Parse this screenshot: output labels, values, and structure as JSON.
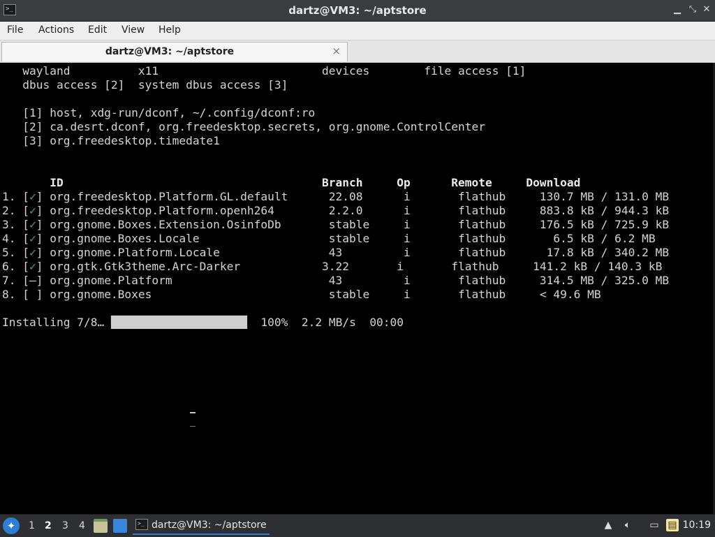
{
  "window": {
    "title": "dartz@VM3: ~/aptstore",
    "app_icon": "terminal-icon",
    "controls": [
      "minimize-icon",
      "restore-icon",
      "close-icon"
    ]
  },
  "menubar": {
    "items": [
      "File",
      "Actions",
      "Edit",
      "View",
      "Help"
    ]
  },
  "tabs": [
    {
      "label": "dartz@VM3: ~/aptstore",
      "close": "×"
    }
  ],
  "terminal": {
    "permissions": [
      "   wayland          x11                        devices        file access [1]",
      "   dbus access [2]  system dbus access [3]"
    ],
    "notes": [
      "   [1] host, xdg-run/dconf, ~/.config/dconf:ro",
      "   [2] ca.desrt.dconf, org.freedesktop.secrets, org.gnome.ControlCenter",
      "   [3] org.freedesktop.timedate1"
    ],
    "header": "       ID                                      Branch     Op      Remote     Download",
    "rows": [
      {
        "prefix": "1. [",
        "mark": "✓",
        "text": "] org.freedesktop.Platform.GL.default      22.08      i       flathub     130.7 MB / 131.0 MB"
      },
      {
        "prefix": "2. [",
        "mark": "✓",
        "text": "] org.freedesktop.Platform.openh264        2.2.0      i       flathub     883.8 kB / 944.3 kB"
      },
      {
        "prefix": "3. [",
        "mark": "✓",
        "text": "] org.gnome.Boxes.Extension.OsinfoDb       stable     i       flathub     176.5 kB / 725.9 kB"
      },
      {
        "prefix": "4. [",
        "mark": "✓",
        "text": "] org.gnome.Boxes.Locale                   stable     i       flathub       6.5 kB / 6.2 MB"
      },
      {
        "prefix": "5. [",
        "mark": "✓",
        "text": "] org.gnome.Platform.Locale                43         i       flathub      17.8 kB / 340.2 MB"
      },
      {
        "prefix": "6. [",
        "mark": "✓",
        "text": "] org.gtk.Gtk3theme.Arc-Darker            3.22       i       flathub     141.2 kB / 140.3 kB"
      },
      {
        "prefix": "7. [",
        "mark": "–",
        "text": "] org.gnome.Platform                       43         i       flathub     314.5 MB / 325.0 MB"
      },
      {
        "prefix": "8. [",
        "mark": " ",
        "text": "] org.gnome.Boxes                          stable     i       flathub     < 49.6 MB"
      }
    ],
    "progress": {
      "label": "Installing 7/8…",
      "bar": "████████████████████",
      "percent": "100%",
      "speed": "2.2 MB/s",
      "eta": "00:00",
      "fraction": 1.0
    }
  },
  "taskbar": {
    "start_icon": "app-menu-icon",
    "workspaces": [
      "1",
      "2",
      "3",
      "4"
    ],
    "active_workspace": "2",
    "launchers": [
      "file-manager-icon",
      "desktop-icon"
    ],
    "task_label": "dartz@VM3: ~/aptstore",
    "tray": [
      "updates-icon",
      "volume-icon",
      "network-icon",
      "clipboard-icon"
    ],
    "clock": "10:19"
  },
  "colors": {
    "terminal_bg": "#000000",
    "terminal_fg": "#d4d4d4",
    "check": "#4fa84f",
    "accent": "#2f7fd0"
  }
}
